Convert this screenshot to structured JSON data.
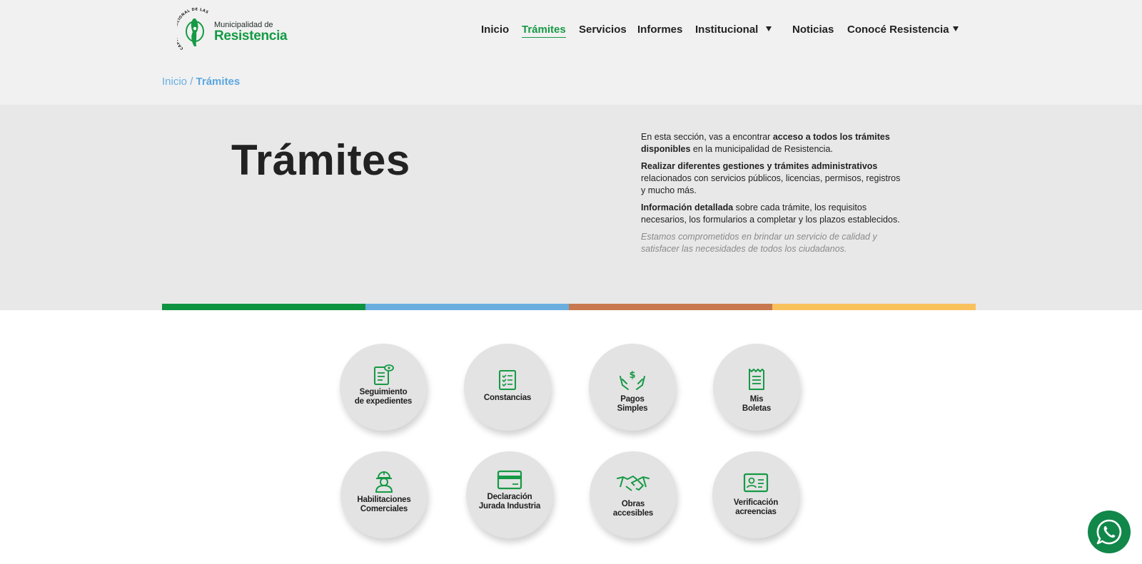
{
  "header": {
    "logo": {
      "ring_text": "CAPITAL NACIONAL DE LAS ESCULTURAS",
      "small": "Municipalidad de",
      "big": "Resistencia"
    },
    "nav": [
      {
        "label": "Inicio",
        "active": false
      },
      {
        "label": "Trámites",
        "active": true
      },
      {
        "label": "Servicios",
        "active": false
      },
      {
        "label": "Informes",
        "active": false
      },
      {
        "label": "Institucional",
        "active": false,
        "dropdown": true
      },
      {
        "label": "Noticias",
        "active": false
      },
      {
        "label": "Conocé Resistencia",
        "active": false,
        "dropdown": true
      }
    ]
  },
  "breadcrumb": {
    "home": "Inicio",
    "separator": "/",
    "current": "Trámites"
  },
  "hero": {
    "title": "Trámites",
    "p1_a": "En esta sección, vas a encontrar ",
    "p1_b": "acceso a todos los trámites disponibles",
    "p1_c": " en la municipalidad de Resistencia.",
    "p2_a": "Realizar diferentes gestiones y trámites administrativos",
    "p2_b": " relacionados con servicios públicos, licencias, permisos, registros y mucho más.",
    "p3_a": "Información detallada",
    "p3_b": " sobre cada trámite, los requisitos necesarios, los formularios a completar y los plazos establecidos.",
    "p4": "Estamos comprometidos en brindar un servicio de calidad y satisfacer las necesidades de todos los ciudadanos."
  },
  "color_bars": [
    "#0e9340",
    "#6aaedf",
    "#c8784e",
    "#f9c15c"
  ],
  "colors": {
    "brand_green": "#179945",
    "breadcrumb_blue": "#6aaee3",
    "whatsapp": "#12874a"
  },
  "tiles": [
    {
      "label": "Seguimiento\nde expedientes",
      "icon": "document-eye-icon"
    },
    {
      "label": "Constancias",
      "icon": "checklist-icon"
    },
    {
      "label": "Pagos\nSimples",
      "icon": "hands-money-icon"
    },
    {
      "label": "Mis\nBoletas",
      "icon": "receipt-icon"
    },
    {
      "label": "Habilitaciones\nComerciales",
      "icon": "worker-icon"
    },
    {
      "label": "Declaración\nJurada Industria",
      "icon": "credit-card-icon"
    },
    {
      "label": "Obras\naccesibles",
      "icon": "handshake-icon"
    },
    {
      "label": "Verificación\nacreencias",
      "icon": "id-card-icon"
    }
  ],
  "whatsapp": {
    "icon": "whatsapp-icon"
  }
}
